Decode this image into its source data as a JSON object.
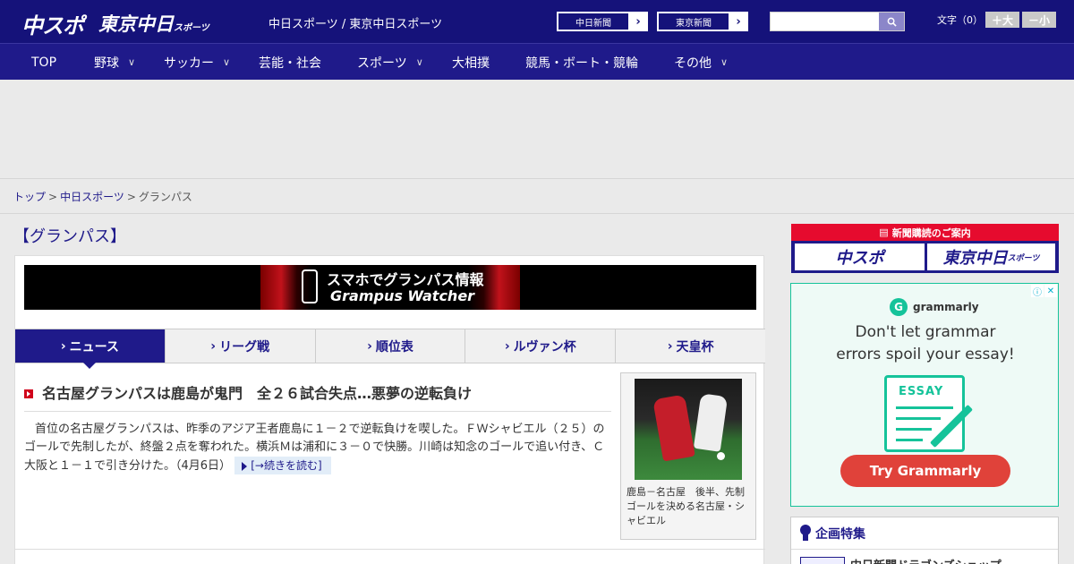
{
  "header": {
    "logo_chuspo": "中スポ",
    "logo_tokyo": "東京中日",
    "logo_tokyo_sub": "スポーツ",
    "site_caption": "中日スポーツ / 東京中日スポーツ",
    "links": [
      {
        "label": "中日新聞"
      },
      {
        "label": "東京新聞"
      }
    ],
    "search_placeholder": "",
    "font_label": "文字（0）",
    "font_larger": "＋大",
    "font_smaller": "－小"
  },
  "nav": {
    "items": [
      {
        "label": "TOP"
      },
      {
        "label": "野球",
        "chevron": "∨"
      },
      {
        "label": "サッカー",
        "chevron": "∨"
      },
      {
        "label": "芸能・社会"
      },
      {
        "label": "スポーツ",
        "chevron": "∨"
      },
      {
        "label": "大相撲"
      },
      {
        "label": "競馬・ボート・競輪"
      },
      {
        "label": "その他",
        "chevron": "∨"
      }
    ]
  },
  "breadcrumb": {
    "items": [
      "トップ",
      "中日スポーツ",
      "グランパス"
    ],
    "separator": ">"
  },
  "page": {
    "title": "【グランパス】"
  },
  "banner": {
    "line1": "スマホでグランパス情報",
    "line2": "Grampus Watcher"
  },
  "tabs": [
    {
      "label": "ニュース",
      "active": true
    },
    {
      "label": "リーグ戦"
    },
    {
      "label": "順位表"
    },
    {
      "label": "ルヴァン杯"
    },
    {
      "label": "天皇杯"
    }
  ],
  "article": {
    "title": "名古屋グランパスは鹿島が鬼門　全２６試合失点…悪夢の逆転負け",
    "body": "首位の名古屋グランパスは、昨季のアジア王者鹿島に１－２で逆転負けを喫した。ＦＷシャビエル（２５）のゴールで先制したが、終盤２点を奪われた。横浜Ｍは浦和に３－０で快勝。川崎は知念のゴールで追い付き、Ｃ大阪と１－１で引き分けた。",
    "date": "（4月6日）",
    "read_more": "[→続きを読む]",
    "photo_caption": "鹿島－名古屋　後半、先制ゴールを決める名古屋・シャビエル"
  },
  "sidebar": {
    "subscribe_head": "新聞購読のご案内",
    "subscribe_btn1": "中スポ",
    "subscribe_btn2": "東京中日",
    "subscribe_btn2_sub": "スポーツ",
    "ad": {
      "brand": "grammarly",
      "headline1": "Don't let grammar",
      "headline2": "errors spoil your essay!",
      "essay_label": "ESSAY",
      "cta": "Try Grammarly",
      "info_icon": "ⓘ",
      "close_icon": "✕"
    },
    "special": {
      "title": "企画特集",
      "first_item": "中日新聞ドラゴンズショップ"
    }
  },
  "colors": {
    "brand_navy": "#15127a",
    "nav_blue": "#1f1a8a",
    "accent_red": "#d0021b",
    "grammarly_green": "#15c39a",
    "grammarly_cta": "#e0423a"
  }
}
